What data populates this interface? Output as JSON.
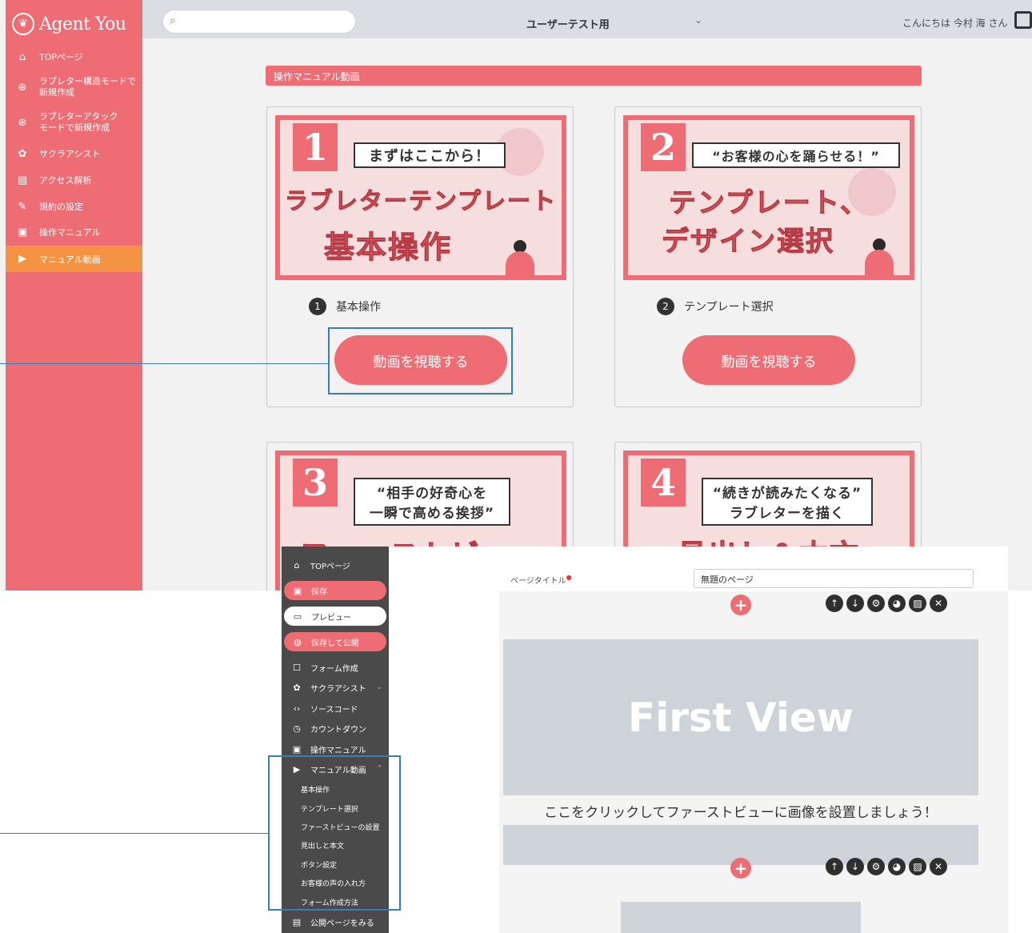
{
  "app": {
    "logo_text": "Agent You",
    "search_placeholder": "",
    "org_name": "ユーザーテスト用",
    "greeting": "こんにちは 今村 海 さん"
  },
  "sidebar": {
    "items": [
      {
        "label": "TOPページ",
        "icon": "home-icon",
        "glyph": "⌂"
      },
      {
        "label1": "ラブレター構造モードで",
        "label2": "新規作成",
        "icon": "plus-circle-icon",
        "glyph": "⊕"
      },
      {
        "label1": "ラブレターアタック",
        "label2": "モードで新規作成",
        "icon": "plus-circle-icon",
        "glyph": "⊕"
      },
      {
        "label": "サクラアシスト",
        "icon": "flower-icon",
        "glyph": "✿"
      },
      {
        "label": "アクセス解析",
        "icon": "chart-icon",
        "glyph": "▤"
      },
      {
        "label": "規約の設定",
        "icon": "document-edit-icon",
        "glyph": "✎"
      },
      {
        "label": "操作マニュアル",
        "icon": "manual-icon",
        "glyph": "▣"
      },
      {
        "label": "マニュアル動画",
        "icon": "video-icon",
        "glyph": "▶"
      }
    ]
  },
  "section_title": "操作マニュアル動画",
  "cards": [
    {
      "num": "1",
      "tagline": "まずはここから！",
      "title1": "ラブレターテンプレート",
      "title2": "基本操作",
      "caption": "基本操作",
      "button": "動画を視聴する"
    },
    {
      "num": "2",
      "tagline": "“お客様の心を踊らせる！”",
      "title1": "テンプレート、",
      "title2": "デザイン選択",
      "caption": "テンプレート選択",
      "button": "動画を視聴する"
    },
    {
      "num": "3",
      "tagline1": "“相手の好奇心を",
      "tagline2": "一瞬で高める挨拶”",
      "title1": "ファーストビュー"
    },
    {
      "num": "4",
      "tagline1": "“続きが読みたくなる”",
      "tagline2": "ラブレターを描く",
      "title1": "見出し＆本文"
    }
  ],
  "editor": {
    "side_items": {
      "top": "TOPページ",
      "save": "保存",
      "preview": "プレビュー",
      "publish": "保存して公開",
      "form": "フォーム作成",
      "sakura": "サクラアシスト",
      "source": "ソースコード",
      "countdown": "カウントダウン",
      "manual": "操作マニュアル",
      "video": "マニュアル動画",
      "public_page": "公開ページをみる"
    },
    "video_sub": [
      "基本操作",
      "テンプレート選択",
      "ファーストビューの設置",
      "見出しと本文",
      "ボタン設定",
      "お客様の声の入れ方",
      "フォーム作成方法"
    ],
    "page_title_label": "ページタイトル",
    "page_title_value": "無題のページ",
    "first_view": "First View",
    "first_view_hint": "ここをクリックしてファーストビューに画像を設置しましょう！",
    "block_controls": [
      "↑",
      "↓",
      "⚙",
      "◕",
      "▨",
      "✕"
    ],
    "plus": "+"
  },
  "colors": {
    "brand": "#ee6c73",
    "active": "#f59345",
    "callout": "#3a7cb5"
  }
}
